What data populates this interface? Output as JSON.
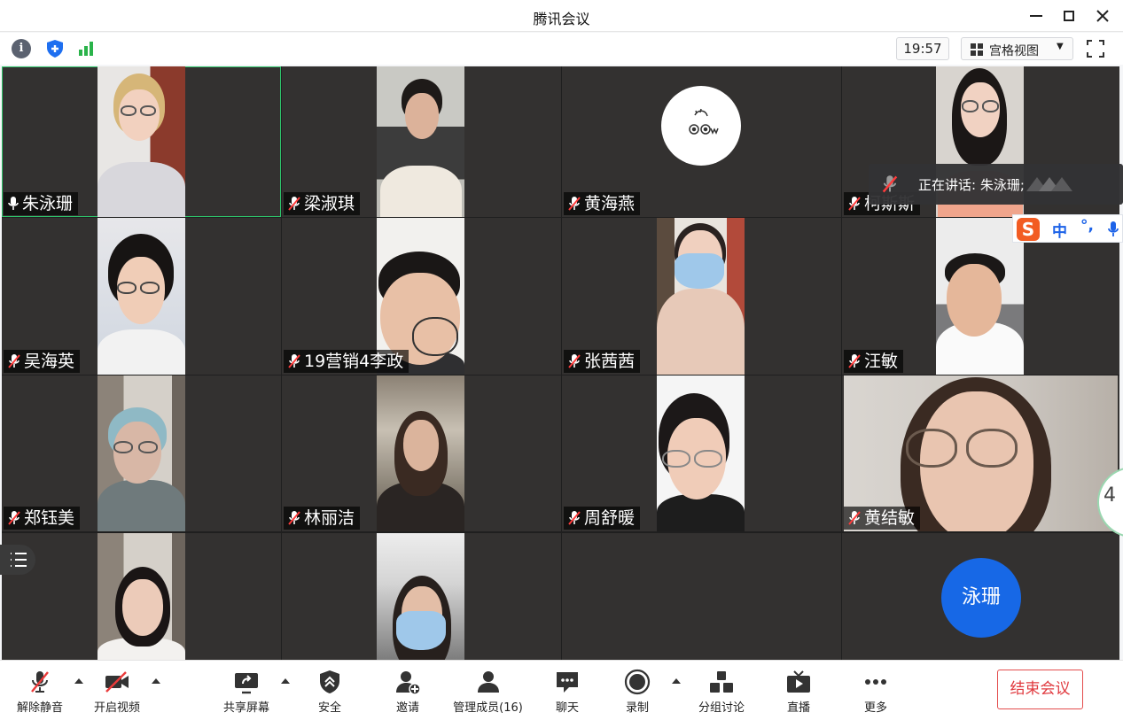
{
  "window": {
    "title": "腾讯会议"
  },
  "infobar": {
    "time": "19:57",
    "view_mode": "宫格视图"
  },
  "tiles": [
    {
      "name": "朱泳珊"
    },
    {
      "name": "梁淑琪"
    },
    {
      "name": "黄海燕"
    },
    {
      "name": "柯斯斯"
    },
    {
      "name": "吴海英"
    },
    {
      "name": "19营销4李政"
    },
    {
      "name": "张茜茜"
    },
    {
      "name": "汪敏"
    },
    {
      "name": "郑钰美"
    },
    {
      "name": "林丽洁"
    },
    {
      "name": "周舒暖"
    },
    {
      "name": "黄结敏"
    }
  ],
  "avatar_tile": {
    "initials": "泳珊"
  },
  "speaking": {
    "text": "正在讲话: 朱泳珊;"
  },
  "ime": {
    "logo": "S",
    "mode": "中",
    "punct": "°,"
  },
  "side_widget": {
    "value": "4"
  },
  "toolbar": {
    "unmute": "解除静音",
    "start_video": "开启视频",
    "share_screen": "共享屏幕",
    "security": "安全",
    "invite": "邀请",
    "manage_members": "管理成员(16)",
    "chat": "聊天",
    "record": "录制",
    "breakout": "分组讨论",
    "live": "直播",
    "more": "更多",
    "end_meeting": "结束会议"
  },
  "colors": {
    "accent": "#1768e6",
    "end_red": "#e0393e",
    "active_border": "#2ec46a",
    "tile_bg": "#333130"
  }
}
